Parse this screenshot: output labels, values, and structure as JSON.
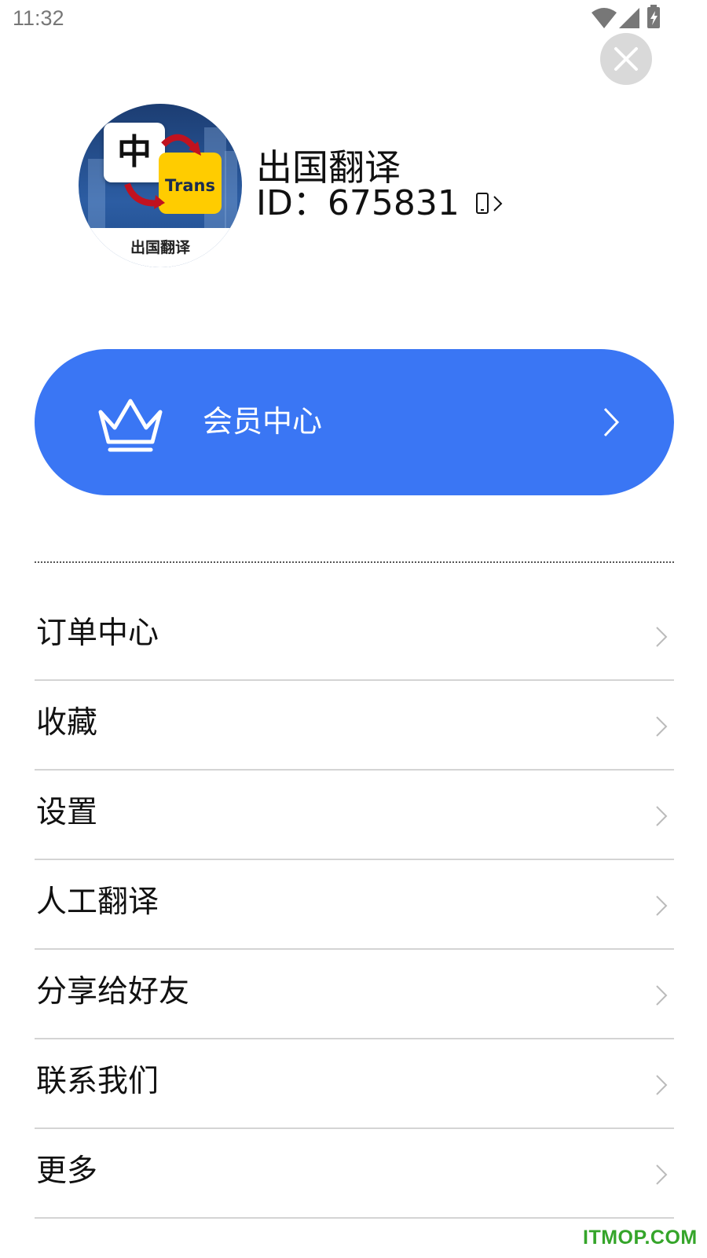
{
  "status_bar": {
    "time": "11:32",
    "icons": [
      "wifi-icon",
      "signal-icon",
      "battery-charging-icon"
    ]
  },
  "close_button": {
    "icon": "close-icon"
  },
  "profile": {
    "avatar": {
      "card_left_text": "中",
      "card_right_text": "Trans",
      "caption": "出国翻译"
    },
    "name": "出国翻译",
    "id_text": "ID：675831",
    "phone_icon": "phone-bind-icon"
  },
  "vip": {
    "label": "会员中心",
    "icon": "crown-icon",
    "color": "#3a76f4"
  },
  "menu": {
    "items": [
      {
        "label": "订单中心"
      },
      {
        "label": "收藏"
      },
      {
        "label": "设置"
      },
      {
        "label": "人工翻译"
      },
      {
        "label": "分享给好友"
      },
      {
        "label": "联系我们"
      },
      {
        "label": "更多"
      }
    ]
  },
  "watermark": "ITMOP.COM"
}
